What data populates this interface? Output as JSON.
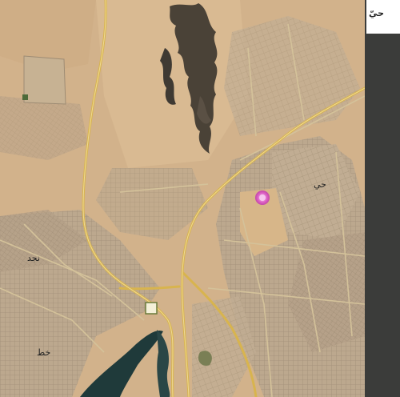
{
  "map": {
    "type": "satellite",
    "markers": [
      {
        "name": "location-pin",
        "color": "#d63fbf"
      }
    ],
    "labels": [
      {
        "text": "حي"
      },
      {
        "text": "نجد"
      },
      {
        "text": "خط"
      }
    ],
    "colors": {
      "desert": "#d2b28b",
      "urban": "#b9a58d",
      "road": "#d9c07a",
      "highway": "#d8b44e",
      "rock": "#3f3a33",
      "water": "#1f3a3a"
    }
  },
  "corner_card": {
    "text": "حيّ",
    "background": "#ffffff"
  },
  "side_panel": {
    "color": "#3b3c3a"
  }
}
